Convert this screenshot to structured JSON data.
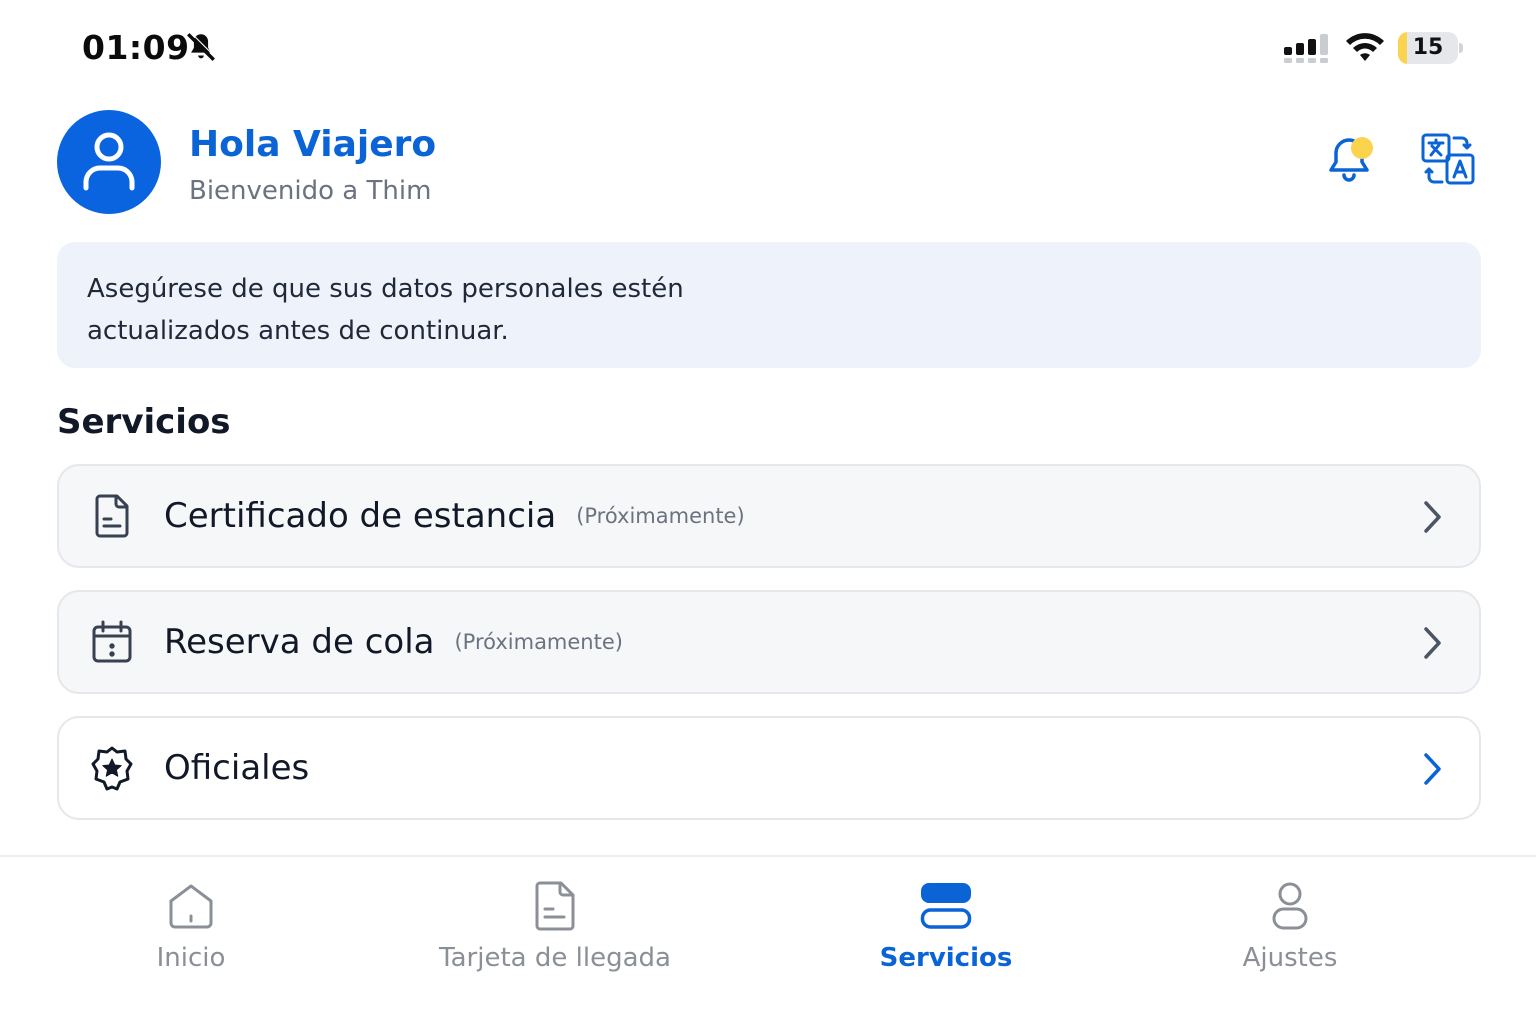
{
  "status_bar": {
    "time": "01:09",
    "battery": "15",
    "battery_level": 0.15,
    "icons": [
      "bell-muted-icon",
      "signal-icon",
      "wifi-icon",
      "battery-icon"
    ]
  },
  "header": {
    "greeting": "Hola Viajero",
    "subtitle": "Bienvenido a Thim",
    "avatar_icon": "user-icon",
    "notification_icon": "bell-icon",
    "translate_icon": "translate-icon"
  },
  "notice": {
    "text": "Asegúrese de que sus datos personales estén actualizados antes de continuar."
  },
  "services": {
    "title": "Servicios",
    "items": [
      {
        "label": "Certificado de estancia",
        "tag": "(Próximamente)",
        "icon": "document-icon",
        "enabled": false
      },
      {
        "label": "Reserva de cola",
        "tag": "(Próximamente)",
        "icon": "calendar-icon",
        "enabled": false
      },
      {
        "label": "Oficiales",
        "tag": "",
        "icon": "police-badge-icon",
        "enabled": true
      }
    ]
  },
  "bottom_nav": {
    "items": [
      {
        "label": "Inicio",
        "icon": "home-icon",
        "active": false
      },
      {
        "label": "Tarjeta de llegada",
        "icon": "document-icon",
        "active": false
      },
      {
        "label": "Servicios",
        "icon": "services-icon",
        "active": true
      },
      {
        "label": "Ajustes",
        "icon": "user-icon",
        "active": false
      }
    ]
  },
  "colors": {
    "accent": "#0a64d6",
    "notice_bg": "#eef3fb",
    "notification_dot": "#fcd34d",
    "muted_text": "#6b7280"
  }
}
